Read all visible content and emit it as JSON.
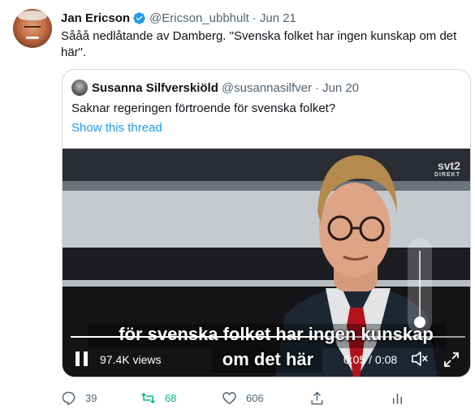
{
  "tweet": {
    "author_name": "Jan Ericson",
    "handle": "@Ericson_ubbhult",
    "separator": "·",
    "time": "Jun 21",
    "text": "Sååå nedlåtande av Damberg. \"Svenska folket har ingen kunskap om det här\"."
  },
  "quote": {
    "author_name": "Susanna Silfverskiöld",
    "handle": "@susannasilfver",
    "separator": "·",
    "time": "Jun 20",
    "text": "Saknar regeringen förtroende för svenska folket?",
    "show_thread": "Show this thread"
  },
  "video": {
    "channel_logo": "svt2",
    "channel_sub": "DIREKT",
    "subtitle_line1": "för svenska folket har ingen kunskap",
    "subtitle_line2": "om det här",
    "views": "97.4K views",
    "time_display": "0:05 / 0:08",
    "progress": 0.625,
    "volume_level": 0.0
  },
  "actions": {
    "replies": "39",
    "retweets": "68",
    "likes": "606"
  },
  "colors": {
    "accent": "#1d9bf0",
    "retweet_active": "#00ba7c",
    "secondary_text": "#536471",
    "border": "#cfd9de"
  },
  "icons": [
    "verified-badge-icon",
    "pause-icon",
    "mute-icon",
    "fullscreen-icon",
    "reply-icon",
    "retweet-icon",
    "like-icon",
    "share-icon",
    "analytics-icon"
  ]
}
